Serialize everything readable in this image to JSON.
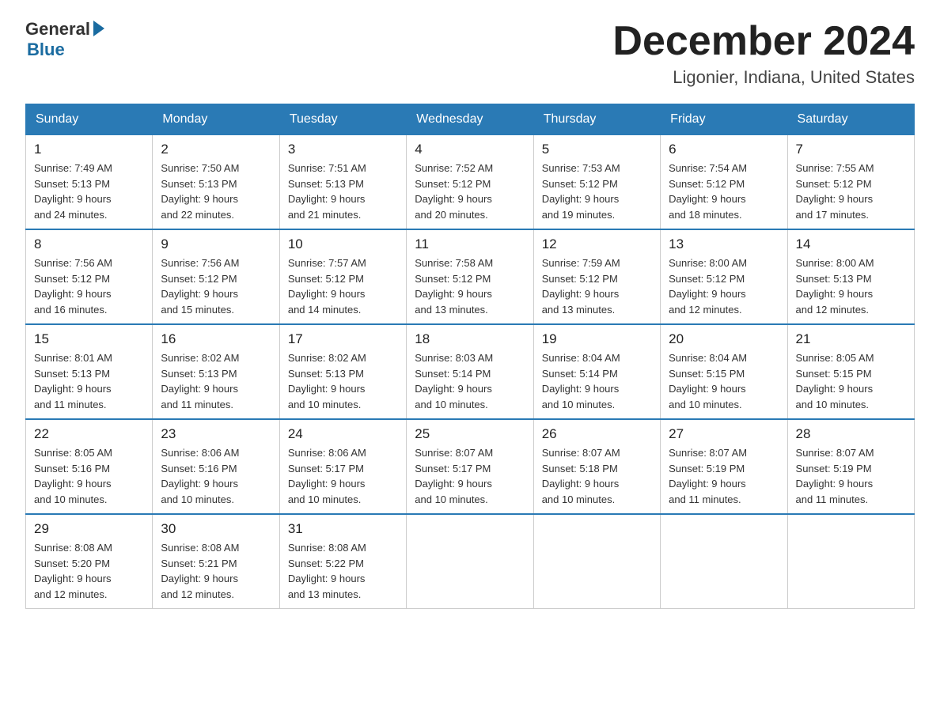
{
  "header": {
    "logo_general": "General",
    "logo_blue": "Blue",
    "title_month": "December 2024",
    "title_location": "Ligonier, Indiana, United States"
  },
  "days_of_week": [
    "Sunday",
    "Monday",
    "Tuesday",
    "Wednesday",
    "Thursday",
    "Friday",
    "Saturday"
  ],
  "weeks": [
    [
      {
        "day": "1",
        "sunrise": "7:49 AM",
        "sunset": "5:13 PM",
        "daylight": "9 hours and 24 minutes."
      },
      {
        "day": "2",
        "sunrise": "7:50 AM",
        "sunset": "5:13 PM",
        "daylight": "9 hours and 22 minutes."
      },
      {
        "day": "3",
        "sunrise": "7:51 AM",
        "sunset": "5:13 PM",
        "daylight": "9 hours and 21 minutes."
      },
      {
        "day": "4",
        "sunrise": "7:52 AM",
        "sunset": "5:12 PM",
        "daylight": "9 hours and 20 minutes."
      },
      {
        "day": "5",
        "sunrise": "7:53 AM",
        "sunset": "5:12 PM",
        "daylight": "9 hours and 19 minutes."
      },
      {
        "day": "6",
        "sunrise": "7:54 AM",
        "sunset": "5:12 PM",
        "daylight": "9 hours and 18 minutes."
      },
      {
        "day": "7",
        "sunrise": "7:55 AM",
        "sunset": "5:12 PM",
        "daylight": "9 hours and 17 minutes."
      }
    ],
    [
      {
        "day": "8",
        "sunrise": "7:56 AM",
        "sunset": "5:12 PM",
        "daylight": "9 hours and 16 minutes."
      },
      {
        "day": "9",
        "sunrise": "7:56 AM",
        "sunset": "5:12 PM",
        "daylight": "9 hours and 15 minutes."
      },
      {
        "day": "10",
        "sunrise": "7:57 AM",
        "sunset": "5:12 PM",
        "daylight": "9 hours and 14 minutes."
      },
      {
        "day": "11",
        "sunrise": "7:58 AM",
        "sunset": "5:12 PM",
        "daylight": "9 hours and 13 minutes."
      },
      {
        "day": "12",
        "sunrise": "7:59 AM",
        "sunset": "5:12 PM",
        "daylight": "9 hours and 13 minutes."
      },
      {
        "day": "13",
        "sunrise": "8:00 AM",
        "sunset": "5:12 PM",
        "daylight": "9 hours and 12 minutes."
      },
      {
        "day": "14",
        "sunrise": "8:00 AM",
        "sunset": "5:13 PM",
        "daylight": "9 hours and 12 minutes."
      }
    ],
    [
      {
        "day": "15",
        "sunrise": "8:01 AM",
        "sunset": "5:13 PM",
        "daylight": "9 hours and 11 minutes."
      },
      {
        "day": "16",
        "sunrise": "8:02 AM",
        "sunset": "5:13 PM",
        "daylight": "9 hours and 11 minutes."
      },
      {
        "day": "17",
        "sunrise": "8:02 AM",
        "sunset": "5:13 PM",
        "daylight": "9 hours and 10 minutes."
      },
      {
        "day": "18",
        "sunrise": "8:03 AM",
        "sunset": "5:14 PM",
        "daylight": "9 hours and 10 minutes."
      },
      {
        "day": "19",
        "sunrise": "8:04 AM",
        "sunset": "5:14 PM",
        "daylight": "9 hours and 10 minutes."
      },
      {
        "day": "20",
        "sunrise": "8:04 AM",
        "sunset": "5:15 PM",
        "daylight": "9 hours and 10 minutes."
      },
      {
        "day": "21",
        "sunrise": "8:05 AM",
        "sunset": "5:15 PM",
        "daylight": "9 hours and 10 minutes."
      }
    ],
    [
      {
        "day": "22",
        "sunrise": "8:05 AM",
        "sunset": "5:16 PM",
        "daylight": "9 hours and 10 minutes."
      },
      {
        "day": "23",
        "sunrise": "8:06 AM",
        "sunset": "5:16 PM",
        "daylight": "9 hours and 10 minutes."
      },
      {
        "day": "24",
        "sunrise": "8:06 AM",
        "sunset": "5:17 PM",
        "daylight": "9 hours and 10 minutes."
      },
      {
        "day": "25",
        "sunrise": "8:07 AM",
        "sunset": "5:17 PM",
        "daylight": "9 hours and 10 minutes."
      },
      {
        "day": "26",
        "sunrise": "8:07 AM",
        "sunset": "5:18 PM",
        "daylight": "9 hours and 10 minutes."
      },
      {
        "day": "27",
        "sunrise": "8:07 AM",
        "sunset": "5:19 PM",
        "daylight": "9 hours and 11 minutes."
      },
      {
        "day": "28",
        "sunrise": "8:07 AM",
        "sunset": "5:19 PM",
        "daylight": "9 hours and 11 minutes."
      }
    ],
    [
      {
        "day": "29",
        "sunrise": "8:08 AM",
        "sunset": "5:20 PM",
        "daylight": "9 hours and 12 minutes."
      },
      {
        "day": "30",
        "sunrise": "8:08 AM",
        "sunset": "5:21 PM",
        "daylight": "9 hours and 12 minutes."
      },
      {
        "day": "31",
        "sunrise": "8:08 AM",
        "sunset": "5:22 PM",
        "daylight": "9 hours and 13 minutes."
      },
      null,
      null,
      null,
      null
    ]
  ],
  "labels": {
    "sunrise": "Sunrise: ",
    "sunset": "Sunset: ",
    "daylight": "Daylight: "
  }
}
